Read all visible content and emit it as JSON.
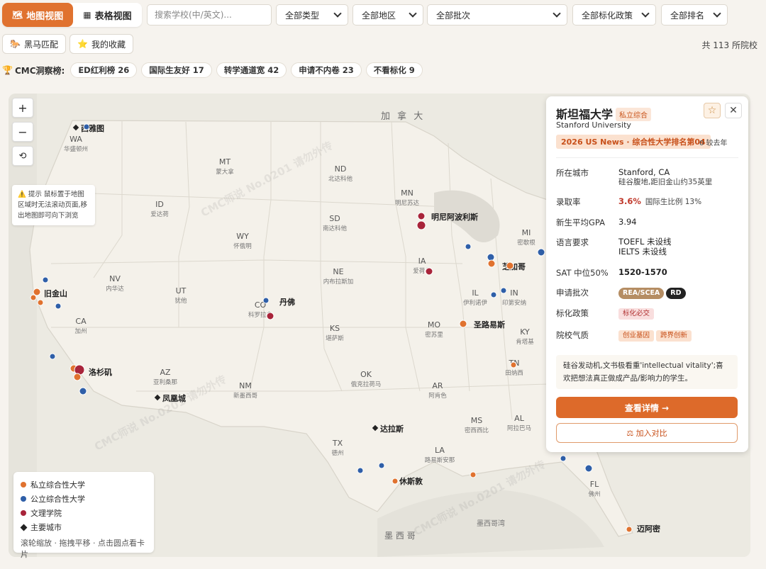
{
  "view_tabs": [
    {
      "label": "地图视图",
      "icon": "map-icon",
      "active": true
    },
    {
      "label": "表格视图",
      "icon": "table-icon",
      "active": false
    }
  ],
  "search": {
    "placeholder": "搜索学校(中/英文)..."
  },
  "filters": [
    "全部类型",
    "全部地区",
    "全部批次",
    "全部标化政策",
    "全部排名"
  ],
  "actions": {
    "dark_horse": "黑马匹配",
    "favorites": "我的收藏"
  },
  "count_text": "共 113 所院校",
  "insight": {
    "label": "CMC洞察榜:",
    "chips": [
      "ED红利榜 26",
      "国际生友好 17",
      "转学通道宽 42",
      "申请不内卷 23",
      "不看标化 9"
    ]
  },
  "map": {
    "zoom_in": "+",
    "zoom_out": "−",
    "reset": "⟲",
    "tip": "提示 鼠标置于地图区域时无法滚动页面,移出地图即可向下浏览",
    "countries": {
      "canada": "加 拿 大",
      "mexico": "墨 西 哥",
      "gulf": "墨西哥湾"
    },
    "states": [
      {
        "abbr": "WA",
        "name": "华盛顿州"
      },
      {
        "abbr": "MT",
        "name": "蒙大拿"
      },
      {
        "abbr": "ND",
        "name": "北达科他"
      },
      {
        "abbr": "MN",
        "name": "明尼苏达"
      },
      {
        "abbr": "ID",
        "name": "爱达荷"
      },
      {
        "abbr": "SD",
        "name": "南达科他"
      },
      {
        "abbr": "WY",
        "name": "怀俄明"
      },
      {
        "abbr": "MI",
        "name": "密歇根"
      },
      {
        "abbr": "IA",
        "name": "爱荷华"
      },
      {
        "abbr": "NE",
        "name": "内布拉斯加"
      },
      {
        "abbr": "NV",
        "name": "内华达"
      },
      {
        "abbr": "UT",
        "name": "犹他"
      },
      {
        "abbr": "CO",
        "name": "科罗拉多"
      },
      {
        "abbr": "IL",
        "name": "伊利诺伊"
      },
      {
        "abbr": "IN",
        "name": "印第安纳"
      },
      {
        "abbr": "CA",
        "name": "加州"
      },
      {
        "abbr": "KS",
        "name": "堪萨斯"
      },
      {
        "abbr": "MO",
        "name": "密苏里"
      },
      {
        "abbr": "KY",
        "name": "肯塔基"
      },
      {
        "abbr": "TN",
        "name": "田纳西"
      },
      {
        "abbr": "AZ",
        "name": "亚利桑那"
      },
      {
        "abbr": "NM",
        "name": "新墨西哥"
      },
      {
        "abbr": "OK",
        "name": "俄克拉荷马"
      },
      {
        "abbr": "AR",
        "name": "阿肯色"
      },
      {
        "abbr": "MS",
        "name": "密西西比"
      },
      {
        "abbr": "AL",
        "name": "阿拉巴马"
      },
      {
        "abbr": "TX",
        "name": "德州"
      },
      {
        "abbr": "LA",
        "name": "路易斯安那"
      },
      {
        "abbr": "FL",
        "name": "佛州"
      }
    ],
    "cities": [
      "西雅图",
      "旧金山",
      "丹佛",
      "明尼阿波利斯",
      "芝加哥",
      "圣路易斯",
      "洛杉矶",
      "凤凰城",
      "达拉斯",
      "休斯敦",
      "迈阿密"
    ]
  },
  "legend": {
    "items": [
      {
        "label": "私立综合性大学",
        "color": "#e0722f",
        "shape": "dot"
      },
      {
        "label": "公立综合性大学",
        "color": "#2f5fa8",
        "shape": "dot"
      },
      {
        "label": "文理学院",
        "color": "#a8243a",
        "shape": "dot"
      },
      {
        "label": "主要城市",
        "color": "#222222",
        "shape": "diamond"
      }
    ],
    "hint": "滚轮缩放 · 拖拽平移 · 点击圆点看卡片"
  },
  "card": {
    "name_cn": "斯坦福大学",
    "type_badge": "私立综合",
    "name_en": "Stanford University",
    "rank_badge": "2026 US News · 综合性大学排名第04",
    "rank_note": "0 较去年",
    "rows": {
      "city": {
        "key": "所在城市",
        "value": "Stanford, CA",
        "sub": "硅谷腹地,距旧金山约35英里"
      },
      "admit": {
        "key": "录取率",
        "value": "3.6%",
        "sub": "国际生比例 13%"
      },
      "gpa": {
        "key": "新生平均GPA",
        "value": "3.94"
      },
      "lang": {
        "key": "语言要求",
        "value": "TOEFL 未设线",
        "sub": "IELTS 未设线"
      },
      "sat": {
        "key": "SAT 中位50%",
        "value": "1520-1570"
      },
      "batch": {
        "key": "申请批次",
        "pills": [
          "REA/SCEA",
          "RD"
        ]
      },
      "test": {
        "key": "标化政策",
        "pill": "标化必交"
      },
      "vibe": {
        "key": "院校气质",
        "tags": [
          "创业基因",
          "跨界创新"
        ]
      }
    },
    "quote": "硅谷发动机,文书极看重'intellectual vitality';喜欢把想法真正做成产品/影响力的学生。",
    "primary_btn": "查看详情 →",
    "secondary_btn": "⚖ 加入对比",
    "star_icon": "☆",
    "close_icon": "✕"
  },
  "watermark": "CMC师说 No.0201 请勿外传",
  "colors": {
    "accent": "#e0722f",
    "private": "#e0722f",
    "public": "#2f5fa8",
    "lac": "#a8243a"
  }
}
